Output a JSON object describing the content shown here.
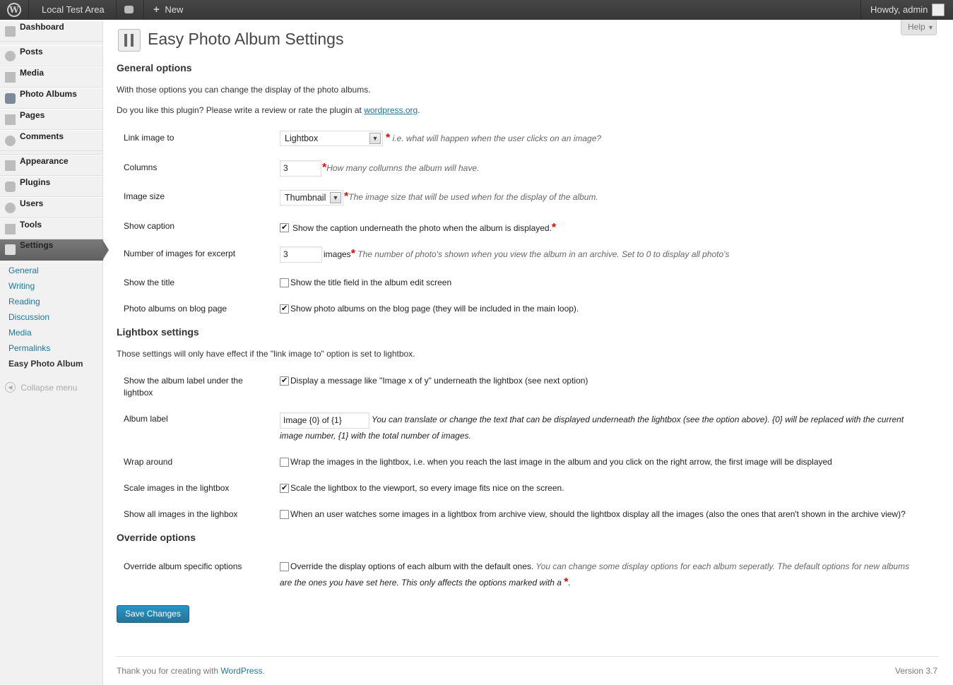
{
  "adminbar": {
    "site_name": "Local Test Area",
    "new_label": "New",
    "howdy": "Howdy, admin"
  },
  "sidebar": {
    "items": [
      {
        "label": "Dashboard",
        "icon": "dashboard-icon"
      },
      {
        "label": "Posts",
        "icon": "pin-icon"
      },
      {
        "label": "Media",
        "icon": "media-icon"
      },
      {
        "label": "Photo Albums",
        "icon": "camera-icon"
      },
      {
        "label": "Pages",
        "icon": "page-icon"
      },
      {
        "label": "Comments",
        "icon": "comment-icon"
      },
      {
        "label": "Appearance",
        "icon": "appearance-icon"
      },
      {
        "label": "Plugins",
        "icon": "plugin-icon"
      },
      {
        "label": "Users",
        "icon": "users-icon"
      },
      {
        "label": "Tools",
        "icon": "tools-icon"
      },
      {
        "label": "Settings",
        "icon": "settings-icon"
      }
    ],
    "submenu": [
      "General",
      "Writing",
      "Reading",
      "Discussion",
      "Media",
      "Permalinks",
      "Easy Photo Album"
    ],
    "collapse": "Collapse menu"
  },
  "help": "Help",
  "page_title": "Easy Photo Album Settings",
  "general": {
    "heading": "General options",
    "intro": "With those options you can change the display of the photo albums.",
    "review_prefix": "Do you like this plugin? Please write a review or rate the plugin at ",
    "review_link": "wordpress.org",
    "review_suffix": "."
  },
  "fields": {
    "link_image": {
      "label": "Link image to",
      "value": "Lightbox",
      "desc": " i.e. what will happen when the user clicks on an image?"
    },
    "columns": {
      "label": "Columns",
      "value": "3",
      "desc": "How many collumns the album will have."
    },
    "image_size": {
      "label": "Image size",
      "value": "Thumbnail",
      "desc": "The image size that will be used when for the display of the album."
    },
    "show_caption": {
      "label": "Show caption",
      "text": "Show the caption underneath the photo when the album is displayed."
    },
    "excerpt": {
      "label": "Number of images for excerpt",
      "value": "3",
      "unit": "images",
      "desc": " The number of photo's shown when you view the album in an archive. Set to 0 to display all photo's"
    },
    "show_title": {
      "label": "Show the title",
      "text": "Show the title field in the album edit screen"
    },
    "blog_page": {
      "label": "Photo albums on blog page",
      "text": "Show photo albums on the blog page (they will be included in the main loop)."
    }
  },
  "lightbox": {
    "heading": "Lightbox settings",
    "intro": "Those settings will only have effect if the \"link image to\" option is set to lightbox.",
    "album_label_show": {
      "label1": "Show the album label under the",
      "label2": "lightbox",
      "text": "Display a message like \"Image x of y\" underneath the lightbox (see next option)"
    },
    "album_label": {
      "label": "Album label",
      "value": "Image {0} of {1}",
      "desc1": "You can translate or change the text that can be displayed underneath the lightbox (see the option above). {0} will be replaced with the current",
      "desc2": "image number, {1} with the total number of images."
    },
    "wrap": {
      "label": "Wrap around",
      "text": "Wrap the images in the lightbox, i.e. when you reach the last image in the album and you click on the right arrow, the first image will be displayed"
    },
    "scale": {
      "label": "Scale images in the lightbox",
      "text": "Scale the lightbox to the viewport, so every image fits nice on the screen."
    },
    "show_all": {
      "label": "Show all images in the lighbox",
      "text": "When an user watches some images in a lightbox from archive view, should the lightbox display all the images (also the ones that aren't shown in the archive view)?"
    }
  },
  "override": {
    "heading": "Override options",
    "label": "Override album specific options",
    "text": "Override the display options of each album with the default ones.",
    "desc1": " You can change some display options for each album seperatly. The default options for new albums",
    "desc2": "are the ones you have set here. This only affects the options marked with a "
  },
  "save": "Save Changes",
  "footer": {
    "thanks": "Thank you for creating with ",
    "wp": "WordPress",
    "dot": ".",
    "version": "Version 3.7"
  },
  "star": "*",
  "colors": {
    "link": "#21759b",
    "star": "#ee0000",
    "primary_button": "#21759b"
  }
}
